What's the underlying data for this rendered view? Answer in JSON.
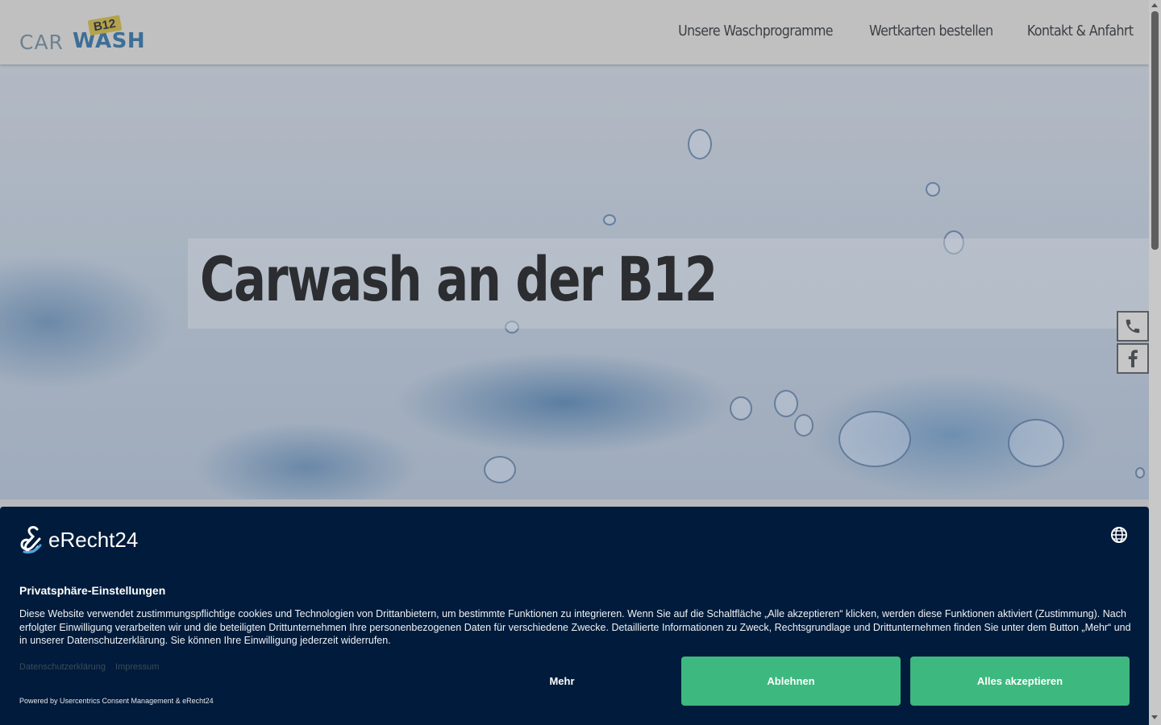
{
  "header": {
    "logo": {
      "b12": "B12",
      "car": "CAR",
      "wash": "WASH"
    },
    "nav": [
      {
        "label": "Unsere Waschprogramme"
      },
      {
        "label": "Wertkarten bestellen"
      },
      {
        "label": "Kontakt & Anfahrt"
      }
    ]
  },
  "hero": {
    "title": "Carwash an der B12"
  },
  "side_buttons": [
    {
      "icon": "phone-icon"
    },
    {
      "icon": "facebook-icon"
    }
  ],
  "consent": {
    "brand": "eRecht24",
    "title": "Privatsphäre-Einstellungen",
    "text": "Diese Website verwendet zustimmungspflichtige cookies und Technologien von Drittanbietern, um bestimmte Funktionen zu integrieren. Wenn Sie auf die Schaltfläche „Alle akzeptieren“ klicken, werden diese Funktionen aktiviert (Zustimmung). Nach erfolgter Einwilligung verarbeiten wir und die beteiligten Drittunternehmen Ihre personenbezogenen Daten für verschiedene Zwecke. Detaillierte Informationen zu Zweck, Rechtsgrundlage und Drittunternehmen finden Sie unter dem Button „Mehr“ und in unserer Datenschutzerklärung. Sie können Ihre Einwilligung jederzeit widerrufen.",
    "links": [
      "Datenschutzerklärung",
      "Impressum"
    ],
    "powered_by": "Powered by Usercentrics Consent Management & eRecht24",
    "buttons": {
      "more": "Mehr",
      "deny": "Ablehnen",
      "accept": "Alles akzeptieren"
    },
    "colors": {
      "background": "#001b3b",
      "button": "#3db87f"
    }
  }
}
